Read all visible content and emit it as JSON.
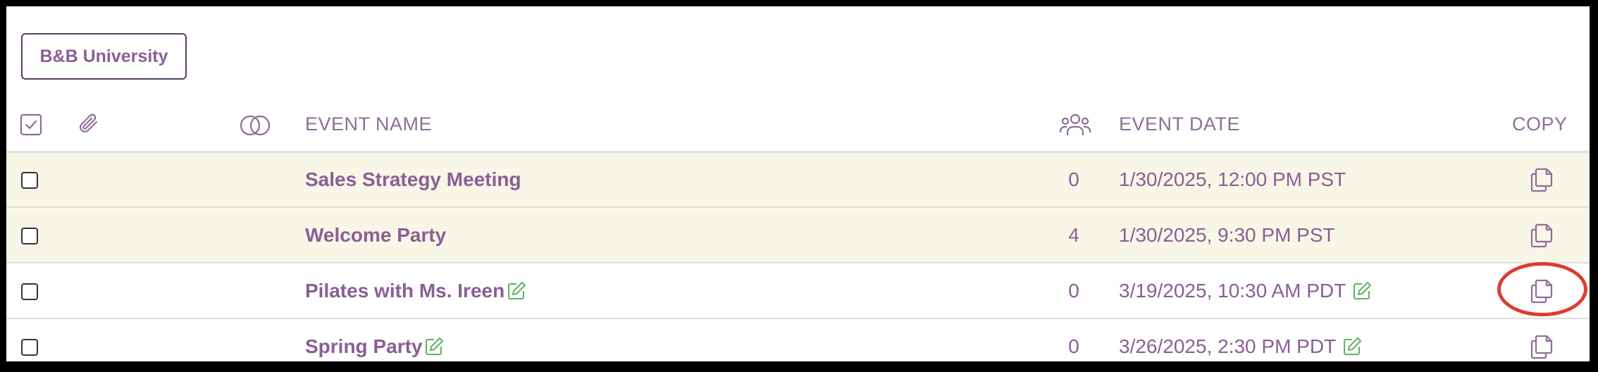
{
  "org": {
    "label": "B&B University"
  },
  "header": {
    "select_all_icon": "checkbox-checked-icon",
    "attachment_icon": "paperclip-icon",
    "overlap_icon": "overlapping-circles-icon",
    "event_name": "EVENT NAME",
    "attendees_icon": "people-group-icon",
    "event_date": "EVENT DATE",
    "copy": "COPY"
  },
  "rows": [
    {
      "name": "Sales Strategy Meeting",
      "count": "0",
      "date": "1/30/2025, 12:00 PM PST",
      "highlighted": true,
      "editable": false
    },
    {
      "name": "Welcome Party",
      "count": "4",
      "date": "1/30/2025, 9:30 PM PST",
      "highlighted": true,
      "editable": false
    },
    {
      "name": "Pilates with Ms. Ireen",
      "count": "0",
      "date": "3/19/2025, 10:30 AM PDT",
      "highlighted": false,
      "editable": true
    },
    {
      "name": "Spring Party",
      "count": "0",
      "date": "3/26/2025, 2:30 PM PDT",
      "highlighted": false,
      "editable": true
    }
  ],
  "colors": {
    "accent": "#8a5e96",
    "highlight_row": "#f8f6e6",
    "edit_green": "#5db35d",
    "annotation_red": "#dd3b2f"
  },
  "annotation": "red circle around copy button of row 3"
}
